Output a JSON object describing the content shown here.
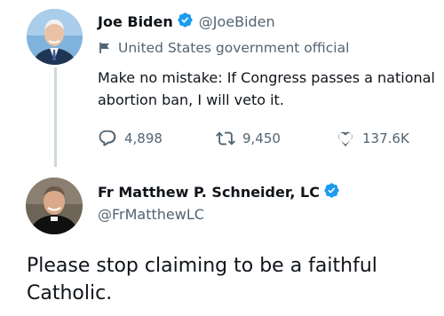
{
  "tweet1": {
    "author_name": "Joe Biden",
    "handle": "@JoeBiden",
    "label": "United States government official",
    "text": "Make no mistake: If Congress passes a national abortion ban, I will veto it.",
    "replies": "4,898",
    "retweets": "9,450",
    "likes": "137.6K"
  },
  "tweet2": {
    "author_name": "Fr Matthew P. Schneider, LC",
    "handle": "@FrMatthewLC",
    "text": "Please stop claiming to be a faithful Catholic."
  },
  "colors": {
    "verified": "#1d9bf0",
    "secondary_text": "#536471",
    "thread_line": "#cfd9de"
  },
  "icons": [
    "verified-badge-icon",
    "flag-icon",
    "reply-icon",
    "retweet-icon",
    "like-icon"
  ]
}
